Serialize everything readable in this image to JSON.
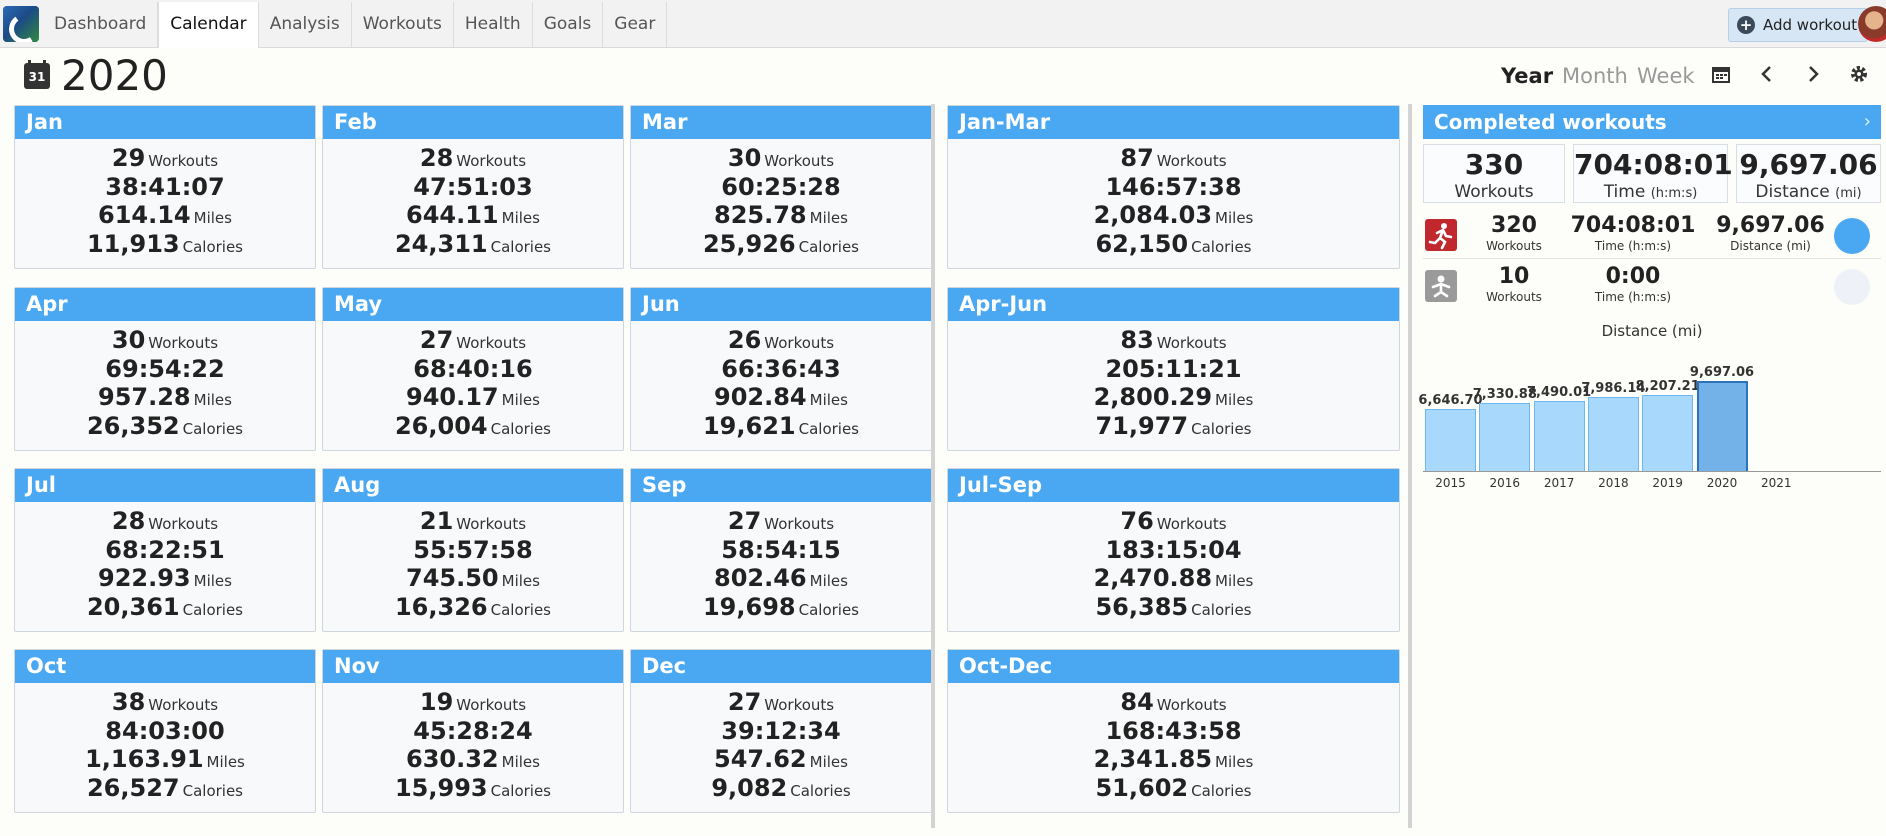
{
  "nav": {
    "tabs": [
      "Dashboard",
      "Calendar",
      "Analysis",
      "Workouts",
      "Health",
      "Goals",
      "Gear"
    ],
    "active_tab": "Calendar",
    "add_workout": "Add workout"
  },
  "title": {
    "calendar_day": "31",
    "year": "2020",
    "views": [
      "Year",
      "Month",
      "Week"
    ],
    "active_view": "Year"
  },
  "labels": {
    "workouts": "Workouts",
    "miles": "Miles",
    "calories": "Calories"
  },
  "months": [
    {
      "name": "Jan",
      "workouts": "29",
      "time": "38:41:07",
      "miles": "614.14",
      "calories": "11,913"
    },
    {
      "name": "Feb",
      "workouts": "28",
      "time": "47:51:03",
      "miles": "644.11",
      "calories": "24,311"
    },
    {
      "name": "Mar",
      "workouts": "30",
      "time": "60:25:28",
      "miles": "825.78",
      "calories": "25,926"
    },
    {
      "name": "Apr",
      "workouts": "30",
      "time": "69:54:22",
      "miles": "957.28",
      "calories": "26,352"
    },
    {
      "name": "May",
      "workouts": "27",
      "time": "68:40:16",
      "miles": "940.17",
      "calories": "26,004"
    },
    {
      "name": "Jun",
      "workouts": "26",
      "time": "66:36:43",
      "miles": "902.84",
      "calories": "19,621"
    },
    {
      "name": "Jul",
      "workouts": "28",
      "time": "68:22:51",
      "miles": "922.93",
      "calories": "20,361"
    },
    {
      "name": "Aug",
      "workouts": "21",
      "time": "55:57:58",
      "miles": "745.50",
      "calories": "16,326"
    },
    {
      "name": "Sep",
      "workouts": "27",
      "time": "58:54:15",
      "miles": "802.46",
      "calories": "19,698"
    },
    {
      "name": "Oct",
      "workouts": "38",
      "time": "84:03:00",
      "miles": "1,163.91",
      "calories": "26,527"
    },
    {
      "name": "Nov",
      "workouts": "19",
      "time": "45:28:24",
      "miles": "630.32",
      "calories": "15,993"
    },
    {
      "name": "Dec",
      "workouts": "27",
      "time": "39:12:34",
      "miles": "547.62",
      "calories": "9,082"
    }
  ],
  "quarters": [
    {
      "name": "Jan-Mar",
      "workouts": "87",
      "time": "146:57:38",
      "miles": "2,084.03",
      "calories": "62,150"
    },
    {
      "name": "Apr-Jun",
      "workouts": "83",
      "time": "205:11:21",
      "miles": "2,800.29",
      "calories": "71,977"
    },
    {
      "name": "Jul-Sep",
      "workouts": "76",
      "time": "183:15:04",
      "miles": "2,470.88",
      "calories": "56,385"
    },
    {
      "name": "Oct-Dec",
      "workouts": "84",
      "time": "168:43:58",
      "miles": "2,341.85",
      "calories": "51,602"
    }
  ],
  "summary": {
    "title": "Completed workouts",
    "totals": {
      "workouts": "330",
      "workouts_label": "Workouts",
      "time": "704:08:01",
      "time_label": "Time",
      "time_unit": "(h:m:s)",
      "distance": "9,697.06",
      "distance_label": "Distance",
      "distance_unit": "(mi)"
    },
    "sports": [
      {
        "icon": "running-icon",
        "workouts": "320",
        "time": "704:08:01",
        "distance": "9,697.06",
        "color": "#4aa8f2"
      },
      {
        "icon": "strength-training-icon",
        "workouts": "10",
        "time": "0:00",
        "distance": "",
        "color": "#eef2f8"
      }
    ],
    "sport_labels": {
      "workouts": "Workouts",
      "time": "Time (h:m:s)",
      "distance": "Distance (mi)"
    }
  },
  "chart_data": {
    "type": "bar",
    "title": "Distance (mi)",
    "categories": [
      "2015",
      "2016",
      "2017",
      "2018",
      "2019",
      "2020",
      "2021"
    ],
    "values": [
      6646.7,
      7330.88,
      7490.01,
      7986.14,
      8207.21,
      9697.06,
      null
    ],
    "value_labels": [
      "6,646.70",
      "7,330.88",
      "7,490.01",
      "7,986.14",
      "8,207.21",
      "9,697.06",
      ""
    ],
    "selected": "2020",
    "colors": {
      "bar": "#a8d8fb",
      "selected": "#72b2e8"
    }
  }
}
